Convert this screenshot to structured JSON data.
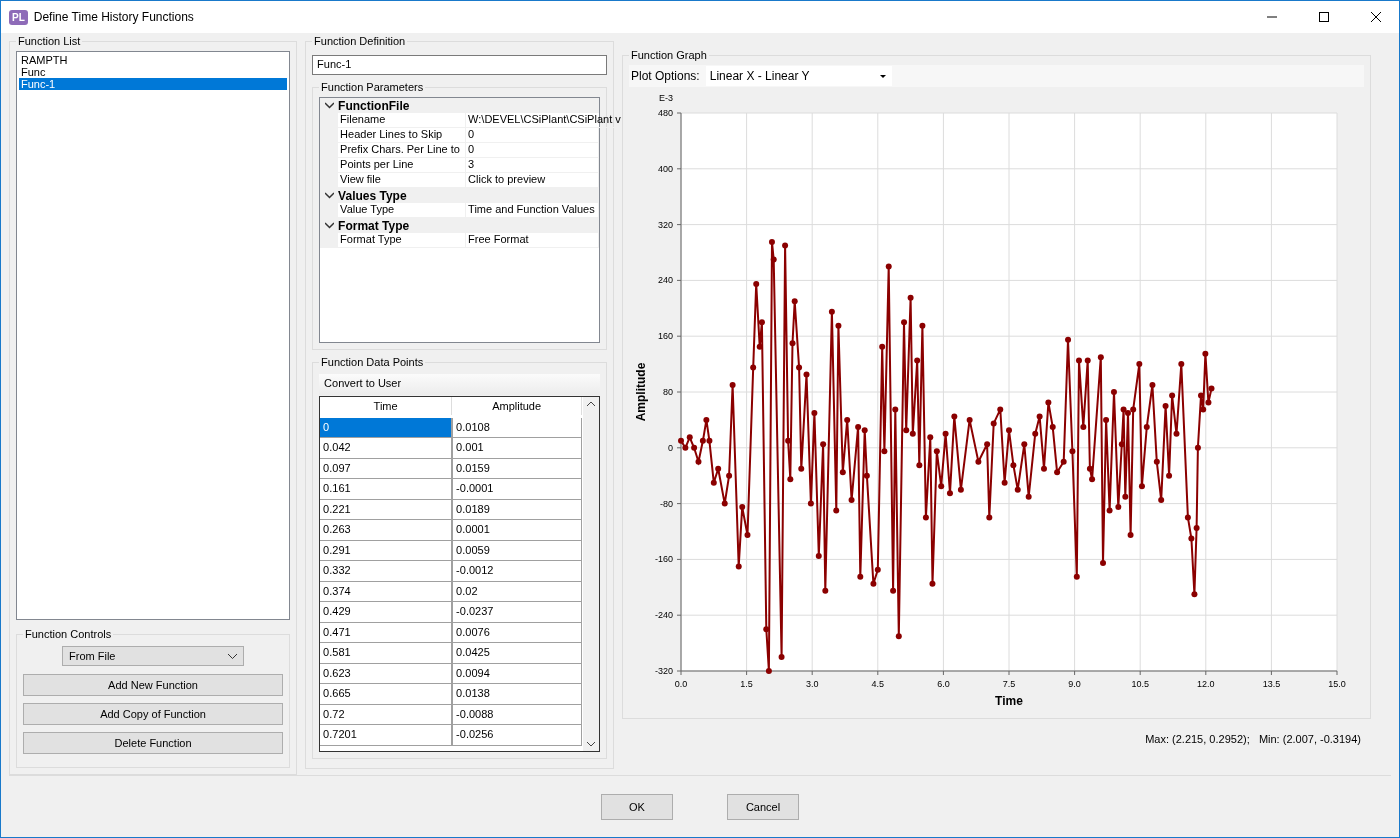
{
  "window": {
    "title": "Define Time History Functions",
    "app_badge": "PL"
  },
  "function_list": {
    "title": "Function List",
    "items": [
      {
        "label": "RAMPTH",
        "selected": false
      },
      {
        "label": "Func",
        "selected": false
      },
      {
        "label": "Func-1",
        "selected": true
      }
    ]
  },
  "function_controls": {
    "title": "Function Controls",
    "type_select": "From File",
    "buttons": [
      "Add New Function",
      "Add Copy of Function",
      "Delete Function"
    ]
  },
  "function_definition": {
    "title": "Function Definition",
    "name": "Func-1",
    "parameters": {
      "title": "Function Parameters",
      "categories": [
        {
          "label": "FunctionFile",
          "expanded": true,
          "properties": [
            {
              "name": "Filename",
              "value": "W:\\DEVEL\\CSiPlant\\CSiPlant v"
            },
            {
              "name": "Header Lines to Skip",
              "value": "0"
            },
            {
              "name": "Prefix Chars. Per Line to",
              "value": "0"
            },
            {
              "name": "Points per Line",
              "value": "3"
            },
            {
              "name": "View file",
              "value": "Click to preview"
            }
          ]
        },
        {
          "label": "Values Type",
          "expanded": true,
          "properties": [
            {
              "name": "Value Type",
              "value": "Time and Function Values"
            }
          ]
        },
        {
          "label": "Format Type",
          "expanded": true,
          "properties": [
            {
              "name": "Format Type",
              "value": "Free Format"
            }
          ]
        }
      ]
    },
    "data_points": {
      "title": "Function Data Points",
      "toolbar_button": "Convert to User",
      "columns": [
        "Time",
        "Amplitude"
      ],
      "rows": [
        {
          "time": "0",
          "amplitude": "0.0108",
          "selected": true
        },
        {
          "time": "0.042",
          "amplitude": "0.001",
          "selected": false
        },
        {
          "time": "0.097",
          "amplitude": "0.0159",
          "selected": false
        },
        {
          "time": "0.161",
          "amplitude": "-0.0001",
          "selected": false
        },
        {
          "time": "0.221",
          "amplitude": "0.0189",
          "selected": false
        },
        {
          "time": "0.263",
          "amplitude": "0.0001",
          "selected": false
        },
        {
          "time": "0.291",
          "amplitude": "0.0059",
          "selected": false
        },
        {
          "time": "0.332",
          "amplitude": "-0.0012",
          "selected": false
        },
        {
          "time": "0.374",
          "amplitude": "0.02",
          "selected": false
        },
        {
          "time": "0.429",
          "amplitude": "-0.0237",
          "selected": false
        },
        {
          "time": "0.471",
          "amplitude": "0.0076",
          "selected": false
        },
        {
          "time": "0.581",
          "amplitude": "0.0425",
          "selected": false
        },
        {
          "time": "0.623",
          "amplitude": "0.0094",
          "selected": false
        },
        {
          "time": "0.665",
          "amplitude": "0.0138",
          "selected": false
        },
        {
          "time": "0.72",
          "amplitude": "-0.0088",
          "selected": false
        },
        {
          "time": "0.7201",
          "amplitude": "-0.0256",
          "selected": false
        }
      ]
    }
  },
  "function_graph": {
    "title": "Function Graph",
    "plot_options_label": "Plot Options:",
    "plot_options_value": "Linear X - Linear Y",
    "scale_label": "E-3",
    "chart_data": {
      "type": "line",
      "grid": true,
      "xlabel": "Time",
      "ylabel": "Amplitude",
      "xlim": [
        0,
        15
      ],
      "ylim": [
        -320,
        480
      ],
      "xticks": [
        {
          "value": 0,
          "label": "0.0"
        },
        {
          "value": 1.5,
          "label": "1.5"
        },
        {
          "value": 3,
          "label": "3.0"
        },
        {
          "value": 4.5,
          "label": "4.5"
        },
        {
          "value": 6,
          "label": "6.0"
        },
        {
          "value": 7.5,
          "label": "7.5"
        },
        {
          "value": 9,
          "label": "9.0"
        },
        {
          "value": 10.5,
          "label": "10.5"
        },
        {
          "value": 12,
          "label": "12.0"
        },
        {
          "value": 13.5,
          "label": "13.5"
        },
        {
          "value": 15,
          "label": "15.0"
        }
      ],
      "yticks": [
        -320,
        -240,
        -160,
        -80,
        0,
        80,
        160,
        240,
        320,
        400,
        480
      ],
      "x": [
        0,
        0.1,
        0.2,
        0.3,
        0.4,
        0.5,
        0.58,
        0.65,
        0.75,
        0.85,
        1.0,
        1.1,
        1.18,
        1.32,
        1.4,
        1.52,
        1.65,
        1.72,
        1.8,
        1.85,
        1.95,
        2.01,
        2.08,
        2.12,
        2.3,
        2.38,
        2.45,
        2.5,
        2.55,
        2.6,
        2.7,
        2.75,
        2.87,
        2.97,
        3.05,
        3.15,
        3.25,
        3.3,
        3.45,
        3.55,
        3.6,
        3.7,
        3.8,
        3.9,
        4.05,
        4.1,
        4.2,
        4.25,
        4.4,
        4.5,
        4.6,
        4.65,
        4.75,
        4.85,
        4.9,
        4.98,
        5.1,
        5.15,
        5.25,
        5.3,
        5.4,
        5.45,
        5.52,
        5.6,
        5.7,
        5.75,
        5.85,
        5.95,
        6.05,
        6.15,
        6.25,
        6.4,
        6.6,
        6.8,
        7.0,
        7.05,
        7.15,
        7.3,
        7.4,
        7.5,
        7.6,
        7.7,
        7.85,
        7.95,
        8.1,
        8.2,
        8.3,
        8.4,
        8.5,
        8.6,
        8.75,
        8.85,
        8.95,
        9.05,
        9.1,
        9.2,
        9.3,
        9.35,
        9.4,
        9.6,
        9.65,
        9.72,
        9.8,
        9.9,
        10.0,
        10.08,
        10.12,
        10.16,
        10.22,
        10.28,
        10.34,
        10.48,
        10.54,
        10.65,
        10.78,
        10.88,
        10.98,
        11.08,
        11.16,
        11.23,
        11.33,
        11.44,
        11.59,
        11.67,
        11.74,
        11.79,
        11.82,
        11.89,
        11.94,
        11.99,
        12.06,
        12.13
      ],
      "series": [
        {
          "color": "#8b0000",
          "marker": "circle",
          "values": [
            10,
            0,
            15,
            0,
            -20,
            10,
            40,
            10,
            -50,
            -30,
            -80,
            -40,
            90,
            -170,
            -85,
            -125,
            115,
            235,
            145,
            180,
            -260,
            -320,
            295,
            270,
            -300,
            290,
            10,
            -45,
            150,
            210,
            115,
            -30,
            105,
            -80,
            50,
            -155,
            5,
            -205,
            195,
            -90,
            175,
            -35,
            40,
            -75,
            30,
            -185,
            25,
            -40,
            -195,
            -175,
            145,
            -5,
            260,
            -205,
            55,
            -270,
            180,
            25,
            215,
            20,
            125,
            -25,
            175,
            -100,
            15,
            -195,
            -5,
            -55,
            20,
            -65,
            45,
            -60,
            40,
            -20,
            5,
            -100,
            35,
            55,
            -50,
            25,
            -25,
            -60,
            5,
            -70,
            20,
            45,
            -30,
            65,
            30,
            -35,
            -20,
            155,
            -5,
            -185,
            125,
            30,
            125,
            -30,
            -45,
            130,
            -165,
            40,
            -90,
            80,
            -85,
            5,
            55,
            -70,
            50,
            -125,
            55,
            120,
            -55,
            30,
            90,
            -20,
            -75,
            60,
            -40,
            75,
            20,
            120,
            -100,
            -130,
            -210,
            -115,
            0,
            75,
            55,
            135,
            65,
            85
          ]
        }
      ]
    },
    "summary": "Max: (2.215, 0.2952);   Min: (2.007, -0.3194)"
  },
  "dialog_buttons": [
    "OK",
    "Cancel"
  ]
}
